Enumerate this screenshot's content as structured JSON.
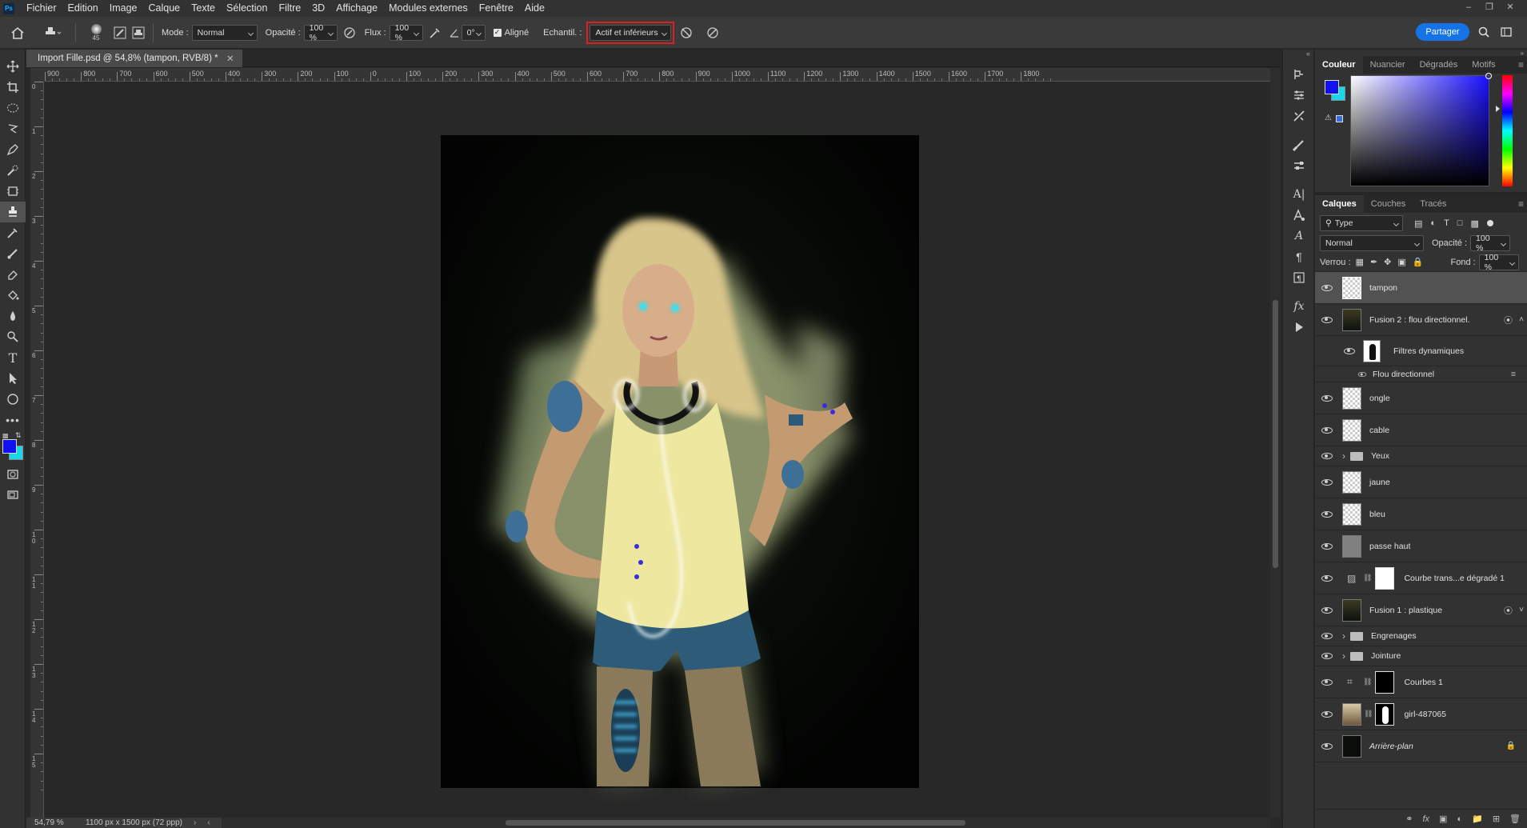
{
  "menubar": {
    "items": [
      "Fichier",
      "Edition",
      "Image",
      "Calque",
      "Texte",
      "Sélection",
      "Filtre",
      "3D",
      "Affichage",
      "Modules externes",
      "Fenêtre",
      "Aide"
    ]
  },
  "options": {
    "brush_size": "45",
    "mode_label": "Mode :",
    "mode_value": "Normal",
    "opacity_label": "Opacité :",
    "opacity_value": "100 %",
    "flux_label": "Flux :",
    "flux_value": "100 %",
    "angle_value": "0°",
    "aligned_label": "Aligné",
    "sample_label": "Echantil. :",
    "sample_value": "Actif et inférieurs",
    "share_label": "Partager"
  },
  "document": {
    "tab_title": "Import Fille.psd @ 54,8% (tampon, RVB/8) *",
    "zoom": "54,79 %",
    "dimensions": "1100 px x 1500 px (72 ppp)"
  },
  "ruler": {
    "h_ticks": [
      "900",
      "800",
      "700",
      "600",
      "500",
      "400",
      "300",
      "200",
      "100",
      "0",
      "100",
      "200",
      "300",
      "400",
      "500",
      "600",
      "700",
      "800",
      "900",
      "1000",
      "1100",
      "1200",
      "1300",
      "1400",
      "1500",
      "1600",
      "1700",
      "1800"
    ],
    "v_ticks": [
      "0",
      "1",
      "2",
      "3",
      "4",
      "5",
      "6",
      "7",
      "8",
      "9",
      "1 0",
      "1 1",
      "1 2",
      "1 3",
      "1 4",
      "1 5"
    ]
  },
  "color_panel": {
    "tabs": [
      "Couleur",
      "Nuancier",
      "Dégradés",
      "Motifs"
    ],
    "foreground": "#1010f0",
    "background": "#18d8e8"
  },
  "layers_panel": {
    "tabs": [
      "Calques",
      "Couches",
      "Tracés"
    ],
    "filter_value": "Type",
    "blend_value": "Normal",
    "opacity_label": "Opacité :",
    "opacity_value": "100 %",
    "lock_label": "Verrou :",
    "fill_label": "Fond :",
    "fill_value": "100 %",
    "layers": [
      {
        "name": "tampon",
        "kind": "pixel",
        "selected": true
      },
      {
        "name": "Fusion 2 : flou directionnel.",
        "kind": "smart"
      },
      {
        "name": "Filtres dynamiques",
        "kind": "filtermask"
      },
      {
        "name": "Flou directionnel",
        "kind": "filter"
      },
      {
        "name": "ongle",
        "kind": "pixel"
      },
      {
        "name": "cable",
        "kind": "pixel"
      },
      {
        "name": "Yeux",
        "kind": "group"
      },
      {
        "name": "jaune",
        "kind": "pixel"
      },
      {
        "name": "bleu",
        "kind": "pixel"
      },
      {
        "name": "passe haut",
        "kind": "gray"
      },
      {
        "name": "Courbe trans...e dégradé 1",
        "kind": "adjust"
      },
      {
        "name": "Fusion 1 : plastique",
        "kind": "smart"
      },
      {
        "name": "Engrenages",
        "kind": "group"
      },
      {
        "name": "Jointure",
        "kind": "group"
      },
      {
        "name": "Courbes 1",
        "kind": "curves"
      },
      {
        "name": "girl-487065",
        "kind": "photo"
      },
      {
        "name": "Arrière-plan",
        "kind": "background"
      }
    ]
  }
}
